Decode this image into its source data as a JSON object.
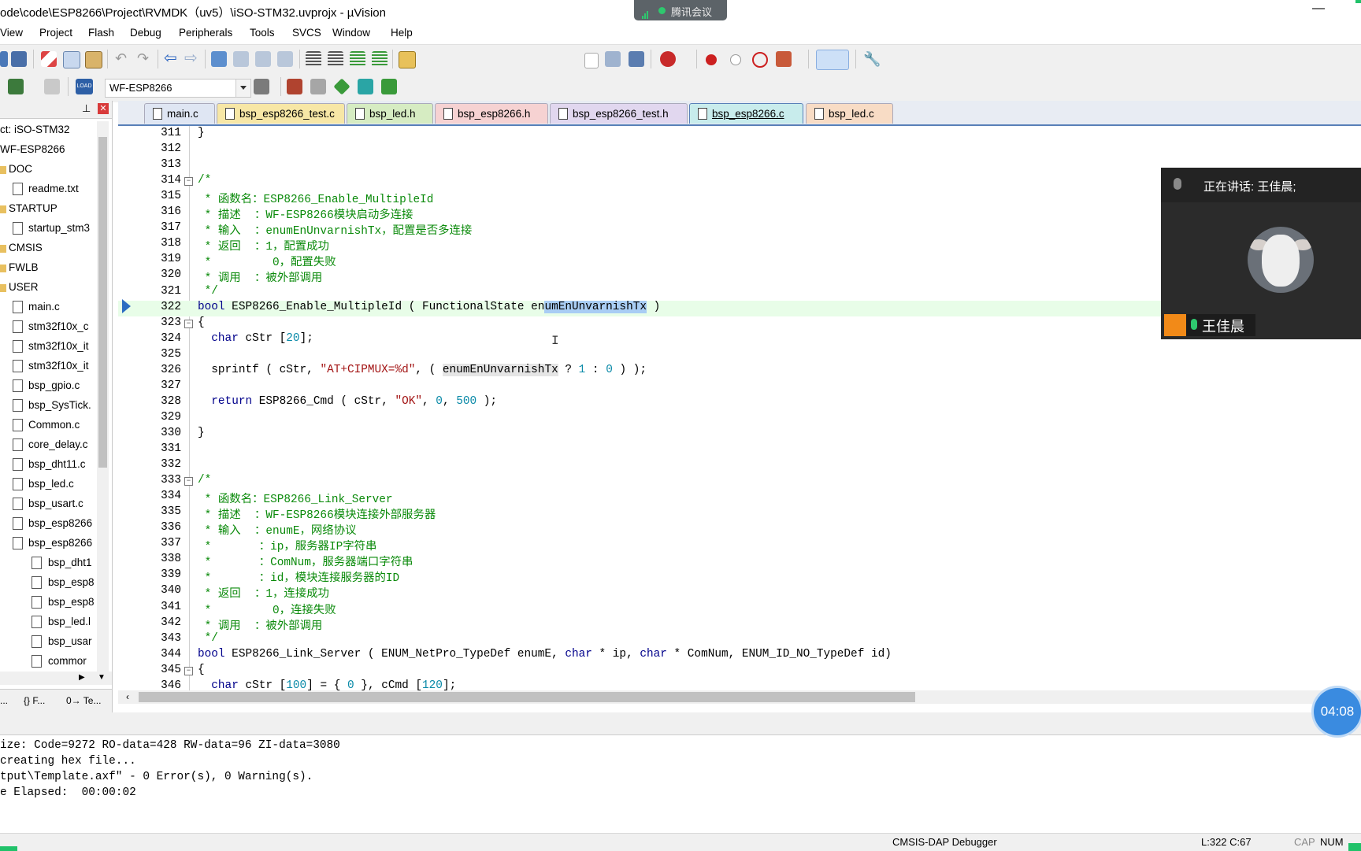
{
  "window": {
    "title": "ode\\code\\ESP8266\\Project\\RVMDK（uv5）\\iSO-STM32.uvprojx - µVision",
    "minimize_glyph": "—"
  },
  "meeting": {
    "label": "腾讯会议"
  },
  "menu": [
    "View",
    "Project",
    "Flash",
    "Debug",
    "Peripherals",
    "Tools",
    "SVCS",
    "Window",
    "Help"
  ],
  "toolbar": {
    "target": "WF-ESP8266",
    "load_label": "LOAD"
  },
  "project": {
    "header_pin": "ᵖ",
    "items": [
      {
        "label": "ct: iSO-STM32",
        "type": "root"
      },
      {
        "label": "WF-ESP8266",
        "type": "target"
      },
      {
        "label": "DOC",
        "type": "folder"
      },
      {
        "label": "readme.txt",
        "type": "file"
      },
      {
        "label": "STARTUP",
        "type": "folder"
      },
      {
        "label": "startup_stm3",
        "type": "file"
      },
      {
        "label": "CMSIS",
        "type": "folder"
      },
      {
        "label": "FWLB",
        "type": "folder"
      },
      {
        "label": "USER",
        "type": "folder"
      },
      {
        "label": "main.c",
        "type": "file"
      },
      {
        "label": "stm32f10x_c",
        "type": "file"
      },
      {
        "label": "stm32f10x_it",
        "type": "file"
      },
      {
        "label": "stm32f10x_it",
        "type": "file"
      },
      {
        "label": "bsp_gpio.c",
        "type": "file"
      },
      {
        "label": "bsp_SysTick.",
        "type": "file"
      },
      {
        "label": "Common.c",
        "type": "file"
      },
      {
        "label": "core_delay.c",
        "type": "file"
      },
      {
        "label": "bsp_dht11.c",
        "type": "file"
      },
      {
        "label": "bsp_led.c",
        "type": "file"
      },
      {
        "label": "bsp_usart.c",
        "type": "file"
      },
      {
        "label": "bsp_esp8266",
        "type": "file"
      },
      {
        "label": "bsp_esp8266",
        "type": "file"
      },
      {
        "label": "bsp_dht1",
        "type": "subfile"
      },
      {
        "label": "bsp_esp8",
        "type": "subfile"
      },
      {
        "label": "bsp_esp8",
        "type": "subfile"
      },
      {
        "label": "bsp_led.l",
        "type": "subfile"
      },
      {
        "label": "bsp_usar",
        "type": "subfile"
      },
      {
        "label": "commor",
        "type": "subfile"
      }
    ],
    "bottom_tabs": [
      "...",
      "{} F...",
      "0→ Te..."
    ]
  },
  "tabs": [
    {
      "label": "main.c",
      "color": "#dfe6f3"
    },
    {
      "label": "bsp_esp8266_test.c",
      "color": "#f7e7a6"
    },
    {
      "label": "bsp_led.h",
      "color": "#d6ecc2"
    },
    {
      "label": "bsp_esp8266.h",
      "color": "#f6d2d2"
    },
    {
      "label": "bsp_esp8266_test.h",
      "color": "#e1d7ef"
    },
    {
      "label": "bsp_esp8266.c",
      "color": "#c8ecec",
      "active": true
    },
    {
      "label": "bsp_led.c",
      "color": "#f8dcc5"
    }
  ],
  "code": [
    {
      "n": "311",
      "t": "}"
    },
    {
      "n": "312",
      "t": ""
    },
    {
      "n": "313",
      "t": ""
    },
    {
      "n": "314",
      "t": "/*",
      "fold": "−",
      "cls": "c"
    },
    {
      "n": "315",
      "t": " * 函数名：ESP8266_Enable_MultipleId",
      "cls": "c"
    },
    {
      "n": "316",
      "t": " * 描述  ：WF-ESP8266模块启动多连接",
      "cls": "c"
    },
    {
      "n": "317",
      "t": " * 输入  ：enumEnUnvarnishTx，配置是否多连接",
      "cls": "c"
    },
    {
      "n": "318",
      "t": " * 返回  ：1，配置成功",
      "cls": "c"
    },
    {
      "n": "319",
      "t": " *         0，配置失败",
      "cls": "c"
    },
    {
      "n": "320",
      "t": " * 调用  ：被外部调用",
      "cls": "c"
    },
    {
      "n": "321",
      "t": " */",
      "cls": "c"
    },
    {
      "n": "322",
      "t": "",
      "hl": true
    },
    {
      "n": "323",
      "t": "{",
      "fold": "−"
    },
    {
      "n": "324",
      "t": ""
    },
    {
      "n": "325",
      "t": ""
    },
    {
      "n": "326",
      "t": ""
    },
    {
      "n": "327",
      "t": ""
    },
    {
      "n": "328",
      "t": ""
    },
    {
      "n": "329",
      "t": ""
    },
    {
      "n": "330",
      "t": "}"
    },
    {
      "n": "331",
      "t": ""
    },
    {
      "n": "332",
      "t": ""
    },
    {
      "n": "333",
      "t": "/*",
      "fold": "−",
      "cls": "c"
    },
    {
      "n": "334",
      "t": " * 函数名：ESP8266_Link_Server",
      "cls": "c"
    },
    {
      "n": "335",
      "t": " * 描述  ：WF-ESP8266模块连接外部服务器",
      "cls": "c"
    },
    {
      "n": "336",
      "t": " * 输入  ：enumE，网络协议",
      "cls": "c"
    },
    {
      "n": "337",
      "t": " *       ：ip，服务器IP字符串",
      "cls": "c"
    },
    {
      "n": "338",
      "t": " *       ：ComNum，服务器端口字符串",
      "cls": "c"
    },
    {
      "n": "339",
      "t": " *       ：id，模块连接服务器的ID",
      "cls": "c"
    },
    {
      "n": "340",
      "t": " * 返回  ：1，连接成功",
      "cls": "c"
    },
    {
      "n": "341",
      "t": " *         0，连接失败",
      "cls": "c"
    },
    {
      "n": "342",
      "t": " * 调用  ：被外部调用",
      "cls": "c"
    },
    {
      "n": "343",
      "t": " */",
      "cls": "c"
    },
    {
      "n": "344",
      "t": ""
    },
    {
      "n": "345",
      "t": "{",
      "fold": "−"
    },
    {
      "n": "346",
      "t": ""
    }
  ],
  "code_rich": {
    "l322": [
      [
        "bool",
        "k"
      ],
      [
        " ESP8266_Enable_MultipleId ( FunctionalState en",
        ""
      ],
      [
        "umEnUnvarnishTx",
        "sel"
      ],
      [
        " )",
        ""
      ]
    ],
    "l324": [
      [
        "  ",
        ""
      ],
      [
        "char",
        "k"
      ],
      [
        " cStr [",
        ""
      ],
      [
        "20",
        "n"
      ],
      [
        "];",
        ""
      ]
    ],
    "l326": [
      [
        "  sprintf ( cStr, ",
        ""
      ],
      [
        "\"AT+CIPMUX=%d\"",
        "s"
      ],
      [
        ", ( ",
        ""
      ],
      [
        "enumEnUnvarnishTx",
        "hlw"
      ],
      [
        " ? ",
        ""
      ],
      [
        "1",
        "n"
      ],
      [
        " : ",
        ""
      ],
      [
        "0",
        "n"
      ],
      [
        " ) );",
        ""
      ]
    ],
    "l328": [
      [
        "  ",
        ""
      ],
      [
        "return",
        "k"
      ],
      [
        " ESP8266_Cmd ( cStr, ",
        ""
      ],
      [
        "\"OK\"",
        "s"
      ],
      [
        ", ",
        ""
      ],
      [
        "0",
        "n"
      ],
      [
        ", ",
        ""
      ],
      [
        "500",
        "n"
      ],
      [
        " );",
        ""
      ]
    ],
    "l344": [
      [
        "bool",
        "k"
      ],
      [
        " ESP8266_Link_Server ( ENUM_NetPro_TypeDef enumE, ",
        ""
      ],
      [
        "char",
        "k"
      ],
      [
        " * ip, ",
        ""
      ],
      [
        "char",
        "k"
      ],
      [
        " * ComNum, ENUM_ID_NO_TypeDef id)",
        ""
      ]
    ],
    "l346": [
      [
        "  ",
        ""
      ],
      [
        "char",
        "k"
      ],
      [
        " cStr [",
        ""
      ],
      [
        "100",
        "n"
      ],
      [
        "] = { ",
        ""
      ],
      [
        "0",
        "n"
      ],
      [
        " }, cCmd [",
        ""
      ],
      [
        "120",
        "n"
      ],
      [
        "];",
        ""
      ]
    ]
  },
  "output": [
    "ize: Code=9272 RO-data=428 RW-data=96 ZI-data=3080",
    "creating hex file...",
    "tput\\Template.axf\" - 0 Error(s), 0 Warning(s).",
    "e Elapsed:  00:00:02"
  ],
  "status": {
    "debugger": "CMSIS-DAP Debugger",
    "position": "L:322 C:67",
    "caps": "CAP",
    "num": "NUM"
  },
  "video": {
    "speaking_label": "正在讲话: 王佳晨;",
    "name": "王佳晨"
  },
  "timer": "04:08"
}
